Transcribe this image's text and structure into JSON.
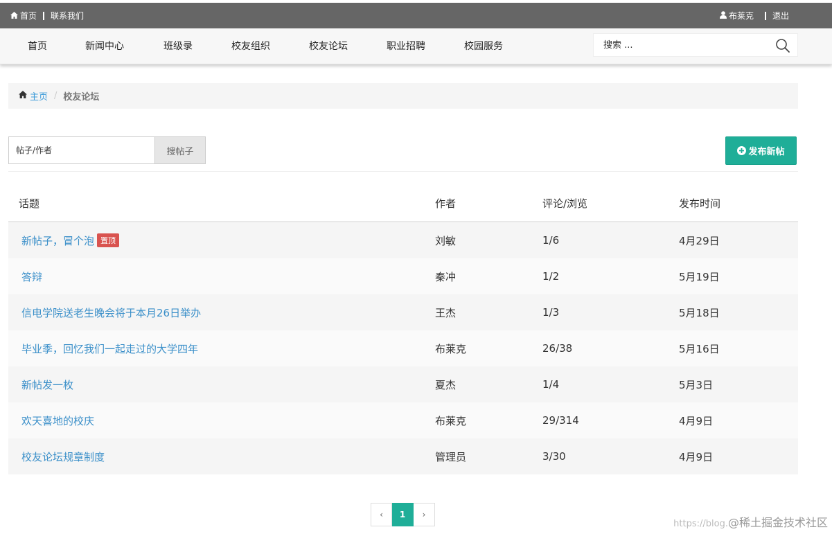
{
  "topbar": {
    "home": "首页",
    "contact": "联系我们",
    "user": "布莱克",
    "logout": "退出"
  },
  "nav": {
    "items": [
      "首页",
      "新闻中心",
      "班级录",
      "校友组织",
      "校友论坛",
      "职业招聘",
      "校园服务"
    ],
    "search_placeholder": "搜索 ..."
  },
  "breadcrumb": {
    "home": "主页",
    "current": "校友论坛"
  },
  "post_search": {
    "placeholder": "帖子/作者",
    "button": "搜帖子"
  },
  "new_post_label": "发布新帖",
  "table": {
    "headers": [
      "话题",
      "作者",
      "评论/浏览",
      "发布时间"
    ],
    "rows": [
      {
        "topic": "新帖子，冒个泡",
        "badge": "置顶",
        "author": "刘敏",
        "stats": "1/6",
        "date": "4月29日"
      },
      {
        "topic": "答辩",
        "badge": "",
        "author": "秦冲",
        "stats": "1/2",
        "date": "5月19日"
      },
      {
        "topic": "信电学院送老生晚会将于本月26日举办",
        "badge": "",
        "author": "王杰",
        "stats": "1/3",
        "date": "5月18日"
      },
      {
        "topic": "毕业季，回忆我们一起走过的大学四年",
        "badge": "",
        "author": "布莱克",
        "stats": "26/38",
        "date": "5月16日"
      },
      {
        "topic": "新帖发一枚",
        "badge": "",
        "author": "夏杰",
        "stats": "1/4",
        "date": "5月3日"
      },
      {
        "topic": "欢天喜地的校庆",
        "badge": "",
        "author": "布莱克",
        "stats": "29/314",
        "date": "4月9日"
      },
      {
        "topic": "校友论坛规章制度",
        "badge": "",
        "author": "管理员",
        "stats": "3/30",
        "date": "4月9日"
      }
    ]
  },
  "pagination": {
    "prev": "‹",
    "current": "1",
    "next": "›"
  },
  "watermark": {
    "url": "https://blog.",
    "text": "@稀土掘金技术社区"
  },
  "colors": {
    "topbar": "#666666",
    "accent": "#1fae98",
    "link": "#3a8fc9",
    "badge": "#d9534f"
  }
}
